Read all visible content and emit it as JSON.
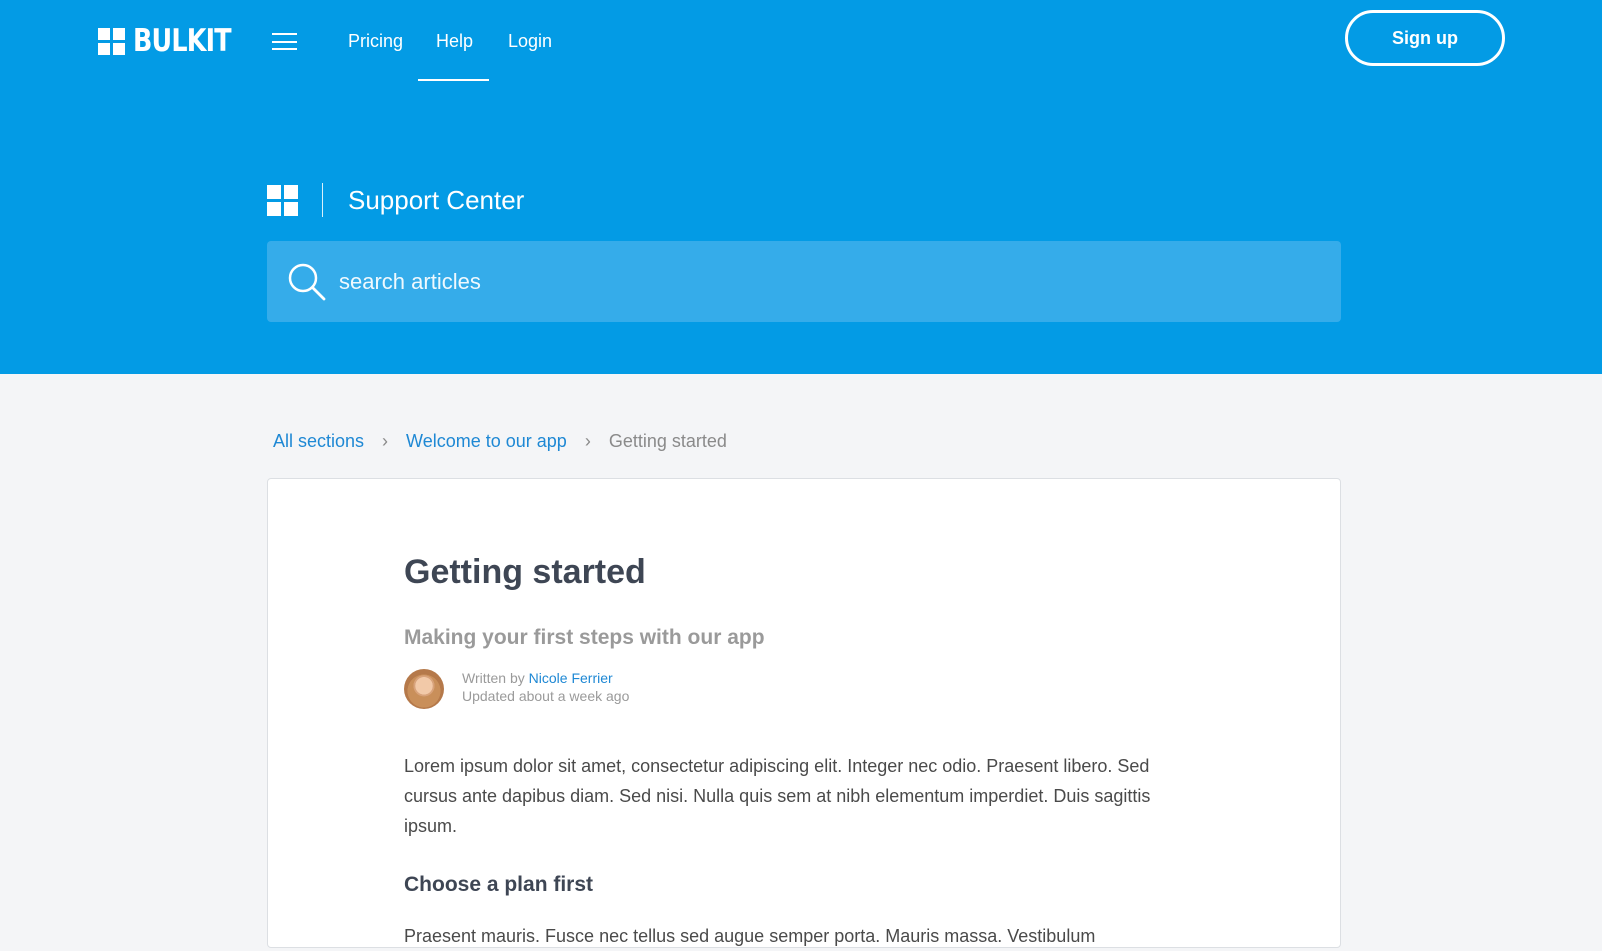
{
  "brand": {
    "name": "BULKIT",
    "icon": "grid-logo-icon"
  },
  "header": {
    "menu_icon": "hamburger-menu-icon",
    "nav": [
      {
        "label": "Pricing"
      },
      {
        "label": "Help",
        "active": true
      },
      {
        "label": "Login"
      }
    ],
    "signup_label": "Sign up"
  },
  "hero": {
    "title": "Support Center",
    "search": {
      "placeholder": "search articles",
      "value": "",
      "icon": "search-icon"
    }
  },
  "breadcrumb": {
    "items": [
      "All sections",
      "Welcome to our app"
    ],
    "current": "Getting started",
    "separator": "›"
  },
  "article": {
    "title": "Getting started",
    "subtitle": "Making your first steps with our app",
    "written_by": "Written by",
    "author": "Nicole Ferrier",
    "updated": "Updated about a week ago",
    "body": "Lorem ipsum dolor sit amet, consectetur adipiscing elit. Integer nec odio. Praesent libero. Sed cursus ante dapibus diam. Sed nisi. Nulla quis sem at nibh elementum imperdiet. Duis sagittis ipsum.",
    "section_heading": "Choose a plan first",
    "next_paragraph": "Praesent mauris. Fusce nec tellus sed augue semper porta. Mauris massa. Vestibulum"
  },
  "colors": {
    "hero": "#039be5",
    "search_bg": "#35acea",
    "link": "#1e88d4",
    "page_bg": "#f4f5f7"
  }
}
